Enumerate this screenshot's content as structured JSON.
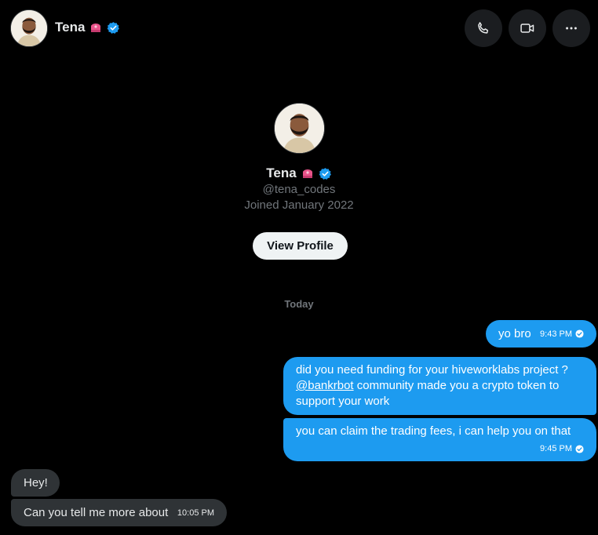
{
  "header": {
    "name": "Tena",
    "icons": {
      "emoji": "crown-emoji-icon",
      "verified": "verified-badge-icon"
    },
    "buttons": [
      {
        "name": "call-button",
        "icon": "phone-icon"
      },
      {
        "name": "video-call-button",
        "icon": "video-icon"
      },
      {
        "name": "more-button",
        "icon": "more-dots-icon"
      }
    ]
  },
  "profile": {
    "name": "Tena",
    "handle": "@tena_codes",
    "joined": "Joined January 2022",
    "view_profile_label": "View Profile"
  },
  "date_separator": "Today",
  "messages": [
    {
      "direction": "outgoing",
      "text": "yo bro",
      "time": "9:43 PM"
    },
    {
      "direction": "outgoing",
      "lines": [
        "did you need funding for your hiveworklabs project ?",
        "@bankrbot",
        " community made you a crypto token to",
        "support your work"
      ]
    },
    {
      "direction": "outgoing",
      "text": "you can claim the trading fees, i can help you on that",
      "time": "9:45 PM"
    },
    {
      "direction": "incoming",
      "text": "Hey!"
    },
    {
      "direction": "incoming",
      "text": "Can you tell me more about",
      "time": "10:05 PM"
    }
  ],
  "colors": {
    "background": "#000000",
    "outgoing_bubble": "#1d9bf0",
    "incoming_bubble": "#2f3336",
    "verified": "#1d9bf0",
    "muted_text": "#71767b"
  }
}
